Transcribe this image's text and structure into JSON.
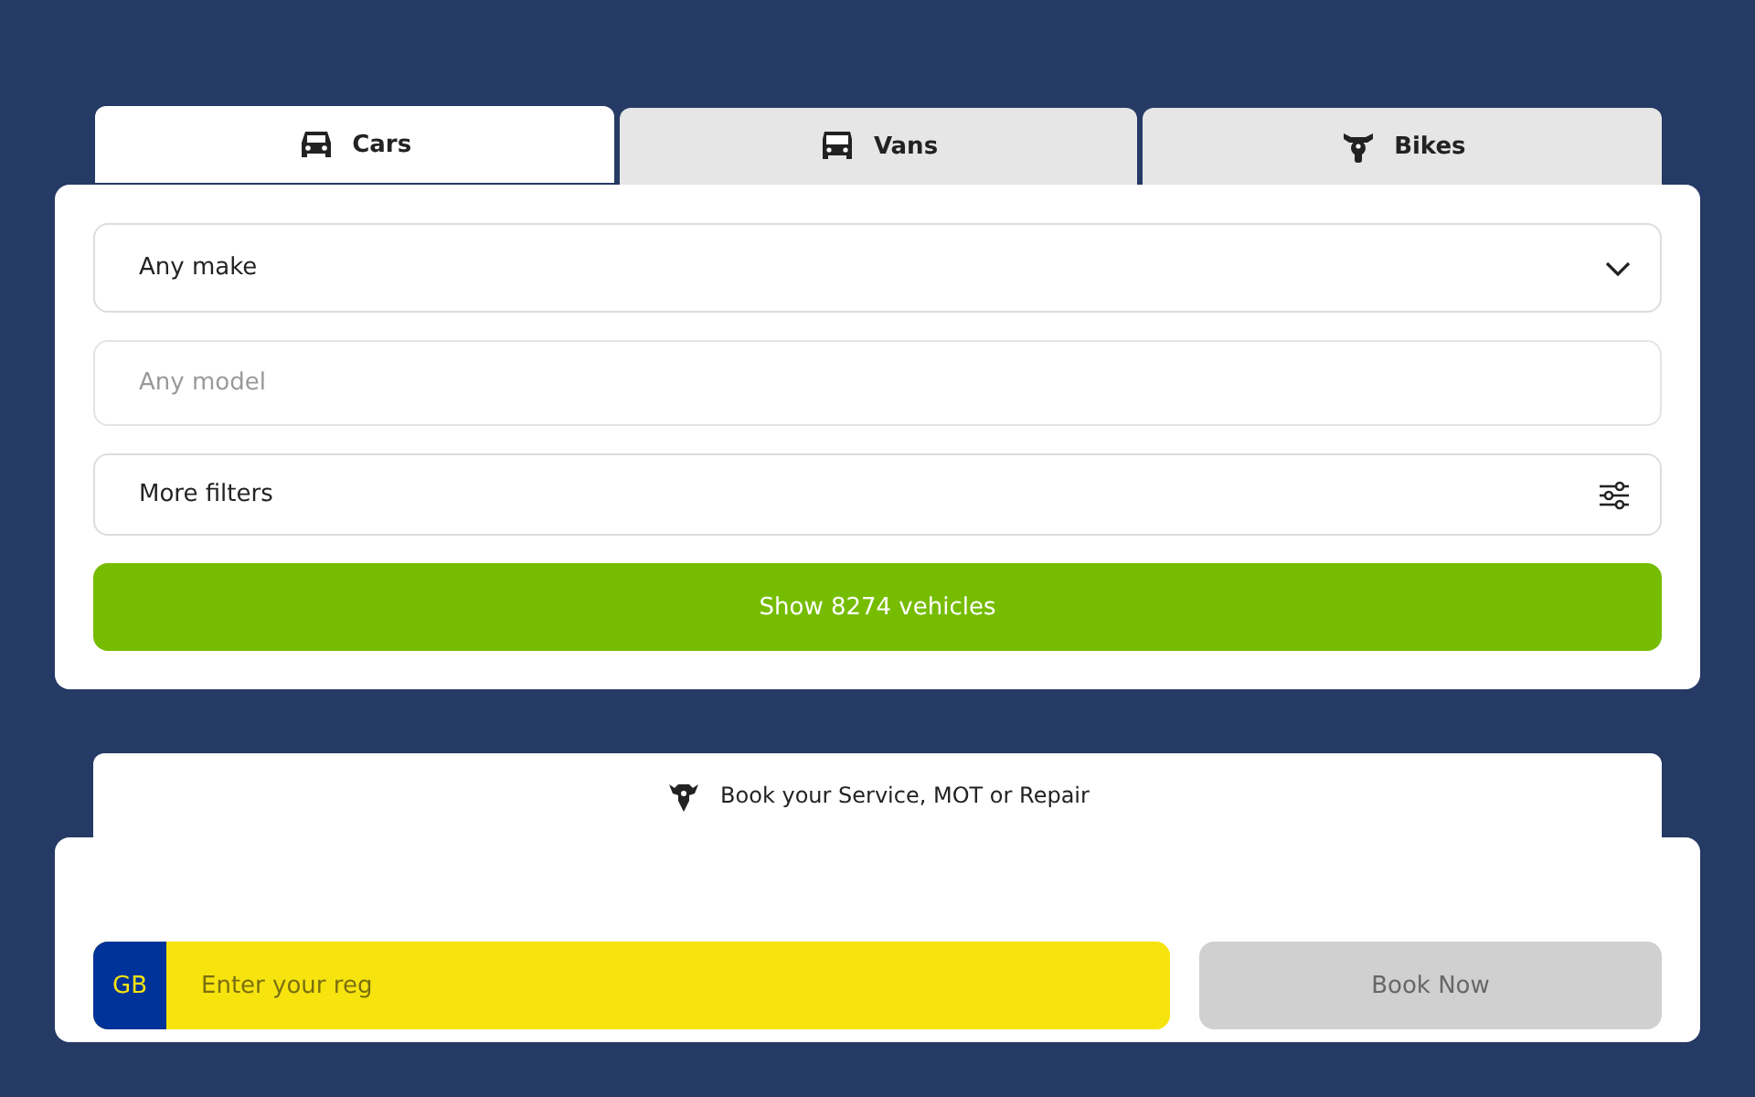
{
  "tabs": [
    {
      "label": "Cars",
      "kind": "car",
      "selected": true
    },
    {
      "label": "Vans",
      "kind": "van",
      "selected": false
    },
    {
      "label": "Bikes",
      "kind": "bike",
      "selected": false
    }
  ],
  "make_select": {
    "value": "Any make"
  },
  "model_field": {
    "placeholder": "Any model"
  },
  "filters": {
    "label": "More filters"
  },
  "search_button": {
    "label": "Show 8274 vehicles"
  },
  "service_tab": {
    "label": "Book your Service, MOT or Repair"
  },
  "reg": {
    "country": "GB",
    "placeholder": "Enter your reg"
  },
  "book_button": {
    "label": "Book Now",
    "disabled": true
  }
}
